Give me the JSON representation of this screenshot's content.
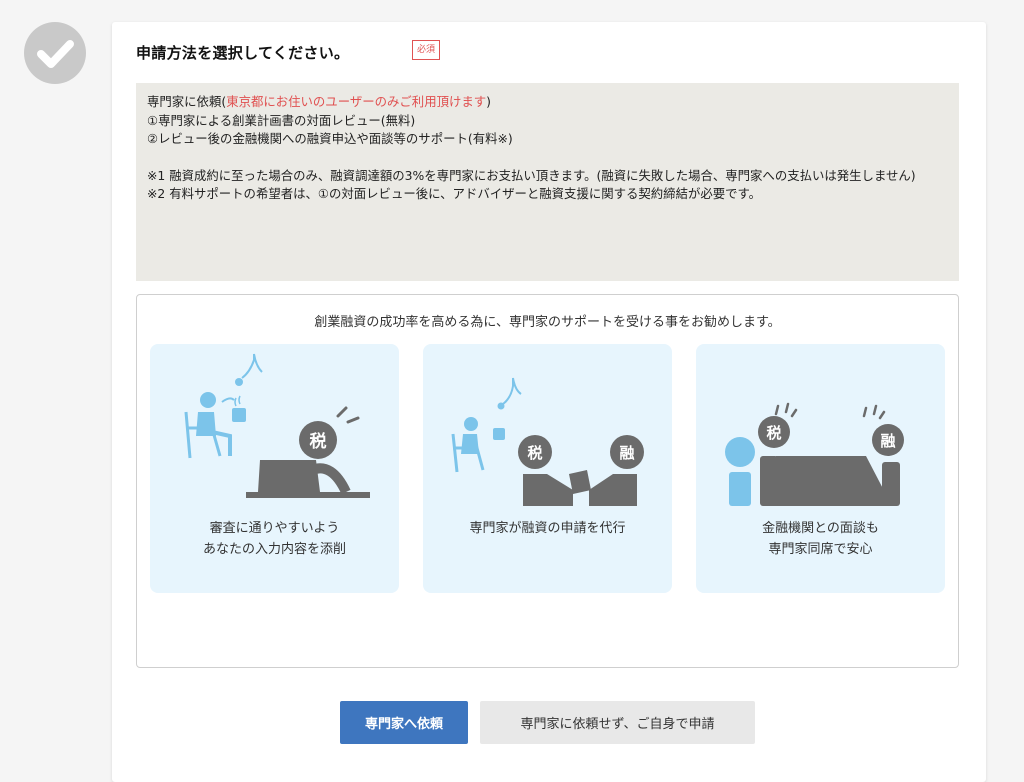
{
  "step": {
    "status_icon": "check-icon"
  },
  "card": {
    "title": "申請方法を選択してください。",
    "required_label": "必須"
  },
  "info": {
    "line1_prefix": "専門家に依頼(",
    "line1_highlight": "東京都にお住いのユーザーのみご利用頂けます",
    "line1_suffix": ")",
    "line2": "①専門家による創業計画書の対面レビュー(無料)",
    "line3": "②レビュー後の金融機関への融資申込や面談等のサポート(有料※)",
    "note1": "※1 融資成約に至った場合のみ、融資調達額の3%を専門家にお支払い頂きます。(融資に失敗した場合、専門家への支払いは発生しません)",
    "note2": "※2 有料サポートの希望者は、①の対面レビュー後に、アドバイザーと融資支援に関する契約締結が必要です。",
    "highlight_color": "#e05050"
  },
  "support": {
    "heading": "創業融資の成功率を高める為に、専門家のサポートを受ける事をお勧めします。",
    "features": [
      {
        "line1": "審査に通りやすいよう",
        "line2": "あなたの入力内容を添削",
        "icon": "tax-advisor-review-illustration",
        "badge1": "税"
      },
      {
        "line1": "専門家が融資の申請を代行",
        "line2": "",
        "icon": "loan-application-illustration",
        "badge1": "税",
        "badge2": "融"
      },
      {
        "line1": "金融機関との面談も",
        "line2": "専門家同席で安心",
        "icon": "bank-interview-illustration",
        "badge1": "税",
        "badge2": "融"
      }
    ]
  },
  "actions": {
    "primary_label": "専門家へ依頼",
    "secondary_label": "専門家に依頼せず、ご自身で申請",
    "primary_color": "#3e76bf"
  }
}
